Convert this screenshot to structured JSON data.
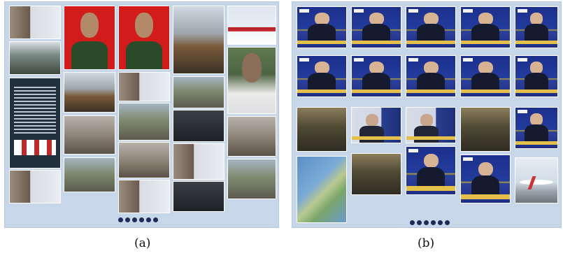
{
  "captions": {
    "a": "(a)",
    "b": "(b)"
  },
  "panels": [
    {
      "id": "a",
      "page_dots": 6
    },
    {
      "id": "b",
      "page_dots": 6
    }
  ],
  "colors": {
    "panel_bg": "#c8d6ea",
    "dot": "#1f2a55",
    "news_blue": "#1c2f8c",
    "news_yellow": "#e4c04a"
  }
}
